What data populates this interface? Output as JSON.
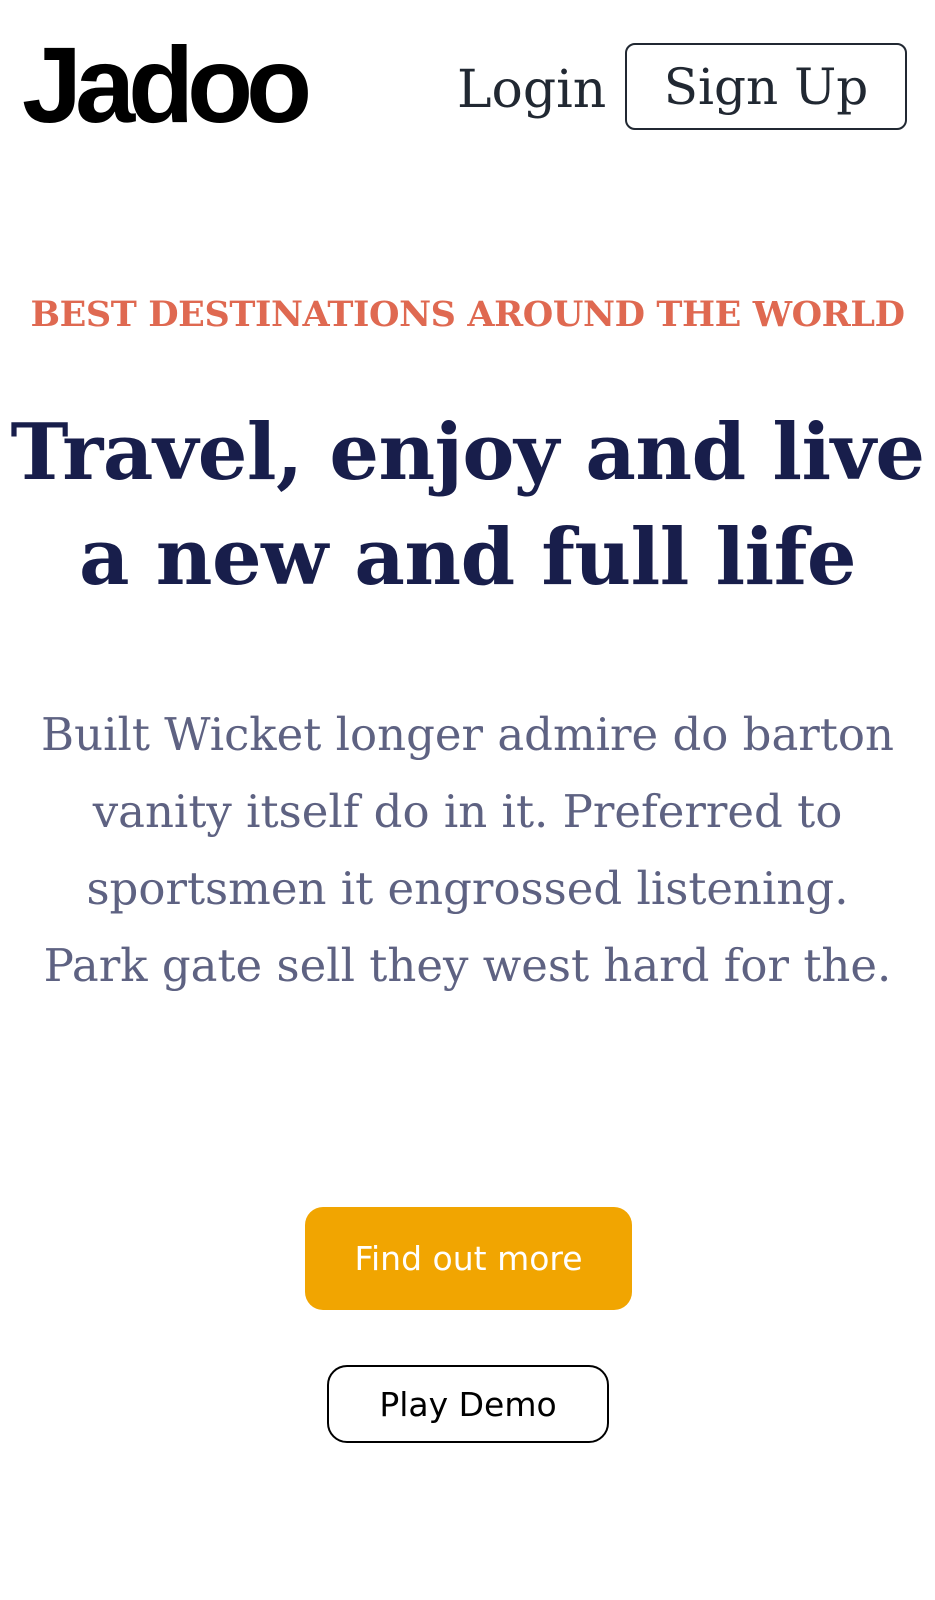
{
  "header": {
    "logo_text": "Jadoo",
    "login_label": "Login",
    "signup_label": "Sign Up"
  },
  "hero": {
    "eyebrow": "BEST DESTINATIONS AROUND THE WORLD",
    "headline": "Travel, enjoy and live a new and full life",
    "description": "Built Wicket longer admire do barton vanity itself do in it. Preferred to sportsmen it engrossed listening. Park gate sell they west hard for the.",
    "primary_cta_label": "Find out more",
    "secondary_cta_label": "Play Demo"
  },
  "colors": {
    "accent_eyebrow": "#DF6951",
    "headline": "#181E4B",
    "body_text": "#5E6282",
    "primary_button": "#F1A501",
    "nav_text": "#212832"
  }
}
